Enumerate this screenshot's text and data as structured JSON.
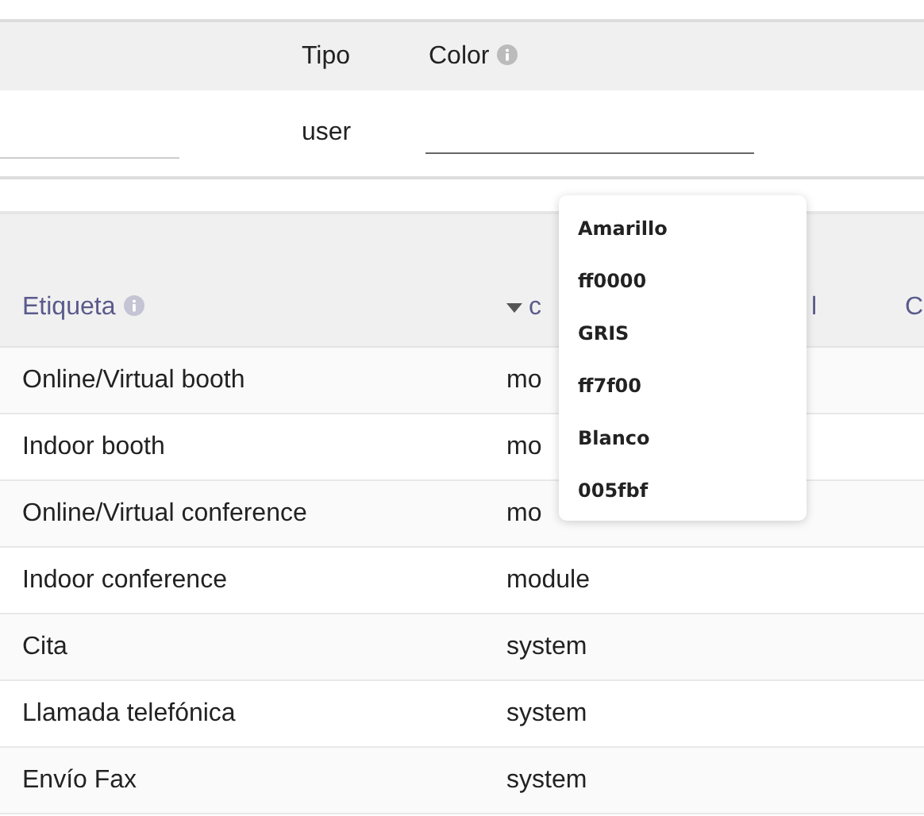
{
  "top_table": {
    "columns": [
      {
        "label": "Tipo",
        "info": false
      },
      {
        "label": "Color",
        "info": true
      }
    ],
    "row": {
      "tipo": "user"
    }
  },
  "main_table": {
    "columns": [
      {
        "label": "Etiqueta",
        "info": true,
        "sorted": false
      },
      {
        "label": "c",
        "info": false,
        "sorted": true
      },
      {
        "label": "l",
        "info": false,
        "sorted": false
      },
      {
        "label": "C",
        "info": false,
        "sorted": false
      }
    ],
    "rows": [
      {
        "etiqueta": "Online/Virtual booth",
        "tipo": "mo"
      },
      {
        "etiqueta": "Indoor booth",
        "tipo": "mo"
      },
      {
        "etiqueta": "Online/Virtual conference",
        "tipo": "mo"
      },
      {
        "etiqueta": "Indoor conference",
        "tipo": "module"
      },
      {
        "etiqueta": "Cita",
        "tipo": "system"
      },
      {
        "etiqueta": "Llamada telefónica",
        "tipo": "system"
      },
      {
        "etiqueta": "Envío Fax",
        "tipo": "system"
      }
    ]
  },
  "color_dropdown": {
    "options": [
      "Amarillo",
      "ff0000",
      "GRIS",
      "ff7f00",
      "Blanco",
      "005fbf"
    ]
  }
}
